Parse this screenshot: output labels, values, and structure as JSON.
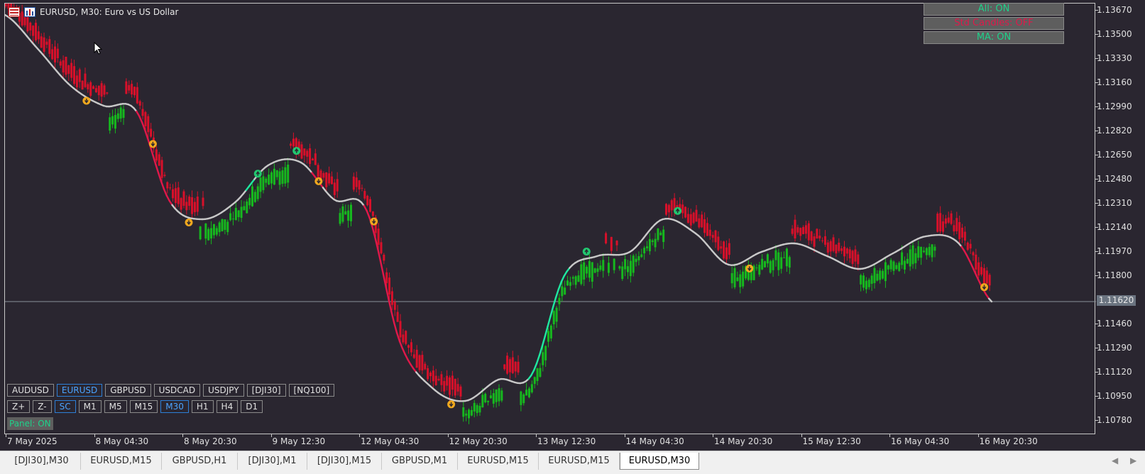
{
  "window": {
    "title": "EURUSD, M30:  Euro vs US Dollar"
  },
  "price_axis": {
    "labels": [
      "1.13670",
      "1.13500",
      "1.13330",
      "1.13160",
      "1.12990",
      "1.12820",
      "1.12650",
      "1.12480",
      "1.12310",
      "1.12140",
      "1.11970",
      "1.11800",
      "1.11460",
      "1.11290",
      "1.11120",
      "1.10950",
      "1.10780"
    ],
    "current_price": "1.11620"
  },
  "time_axis": {
    "labels": [
      "7 May 2025",
      "8 May 04:30",
      "8 May 20:30",
      "9 May 12:30",
      "12 May 04:30",
      "12 May 20:30",
      "13 May 12:30",
      "14 May 04:30",
      "14 May 20:30",
      "15 May 12:30",
      "16 May 04:30",
      "16 May 20:30"
    ]
  },
  "toggle_panel": [
    {
      "label": "All: ON",
      "color": "#1fd18a"
    },
    {
      "label": "Std Candles: OFF",
      "color": "#e0184a"
    },
    {
      "label": "MA: ON",
      "color": "#1fd18a"
    }
  ],
  "symbol_buttons": [
    {
      "label": "AUDUSD",
      "active": false
    },
    {
      "label": "EURUSD",
      "active": true
    },
    {
      "label": "GBPUSD",
      "active": false
    },
    {
      "label": "USDCAD",
      "active": false
    },
    {
      "label": "USDJPY",
      "active": false
    },
    {
      "label": "[DJI30]",
      "active": false
    },
    {
      "label": "[NQ100]",
      "active": false
    }
  ],
  "timeframe_buttons": [
    {
      "label": "Z+",
      "active": false
    },
    {
      "label": "Z-",
      "active": false
    },
    {
      "label": "SC",
      "active": true
    },
    {
      "label": "M1",
      "active": false
    },
    {
      "label": "M5",
      "active": false
    },
    {
      "label": "M15",
      "active": false
    },
    {
      "label": "M30",
      "active": true
    },
    {
      "label": "H1",
      "active": false
    },
    {
      "label": "H4",
      "active": false
    },
    {
      "label": "D1",
      "active": false
    }
  ],
  "panel_toggle": {
    "label": "Panel: ON"
  },
  "tabs": [
    {
      "label": "[DJI30],M30",
      "active": false
    },
    {
      "label": "EURUSD,M15",
      "active": false
    },
    {
      "label": "GBPUSD,H1",
      "active": false
    },
    {
      "label": "[DJI30],M1",
      "active": false
    },
    {
      "label": "[DJI30],M15",
      "active": false
    },
    {
      "label": "GBPUSD,M1",
      "active": false
    },
    {
      "label": "EURUSD,M15",
      "active": false
    },
    {
      "label": "EURUSD,M15",
      "active": false
    },
    {
      "label": "EURUSD,M30",
      "active": true
    }
  ],
  "colors": {
    "background": "#2a2630",
    "bull": "#16b81e",
    "bear": "#d8102a",
    "ma_flat": "#c8c8c8",
    "ma_up": "#1fe8a0",
    "ma_down": "#e0184a",
    "signal_sell": "#f0a81e",
    "signal_buy": "#22c870",
    "accent": "#2d7fd6"
  },
  "chart_data": {
    "type": "line",
    "symbol": "EURUSD",
    "timeframe": "M30",
    "ylim": [
      1.1068,
      1.1372
    ],
    "current_price": 1.1162,
    "x": [
      "7 May 2025",
      "8 May 04:30",
      "8 May 20:30",
      "9 May 12:30",
      "12 May 04:30",
      "12 May 20:30",
      "13 May 12:30",
      "14 May 04:30",
      "14 May 20:30",
      "15 May 12:30",
      "16 May 04:30",
      "16 May 20:30"
    ],
    "series": [
      {
        "values": [
          1.1364,
          1.134,
          1.1314,
          1.13,
          1.1296,
          1.1233,
          1.122,
          1.1232,
          1.1258,
          1.126,
          1.1234,
          1.1226,
          1.1134,
          1.1101,
          1.1092,
          1.1107,
          1.111,
          1.118,
          1.1194,
          1.1197,
          1.122,
          1.121,
          1.1188,
          1.1197,
          1.1203,
          1.1194,
          1.1185,
          1.1196,
          1.1208,
          1.1203,
          1.1162
        ]
      }
    ],
    "signals": [
      {
        "type": "sell",
        "x": "8 May 00:00"
      },
      {
        "type": "sell",
        "x": "8 May 14:00"
      },
      {
        "type": "sell",
        "x": "8 May 20:30"
      },
      {
        "type": "buy",
        "x": "9 May 09:00"
      },
      {
        "type": "buy",
        "x": "9 May 16:00"
      },
      {
        "type": "sell",
        "x": "9 May 20:00"
      },
      {
        "type": "sell",
        "x": "12 May 06:00"
      },
      {
        "type": "sell",
        "x": "12 May 20:00"
      },
      {
        "type": "buy",
        "x": "13 May 20:30"
      },
      {
        "type": "buy",
        "x": "14 May 13:00"
      },
      {
        "type": "sell",
        "x": "15 May 02:00"
      },
      {
        "type": "sell",
        "x": "16 May 20:30"
      }
    ]
  }
}
